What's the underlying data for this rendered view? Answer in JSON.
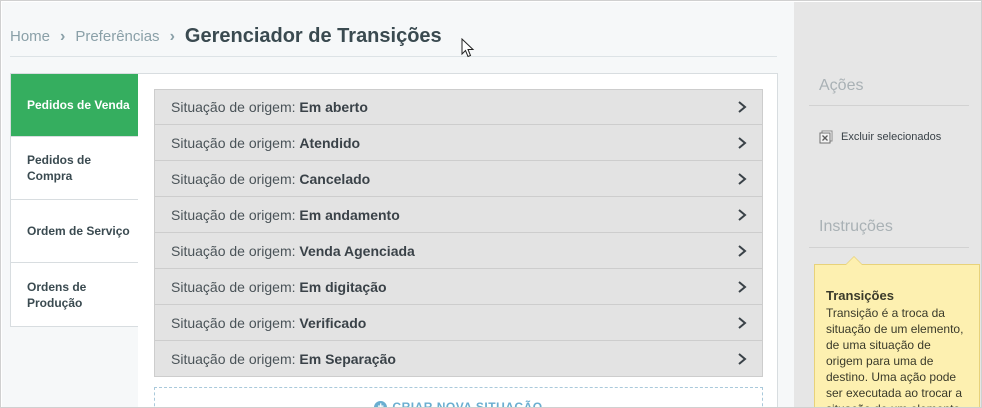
{
  "breadcrumb": {
    "home": "Home",
    "preferences": "Preferências",
    "separator": "›",
    "title": "Gerenciador de Transições"
  },
  "tabs": [
    {
      "label": "Pedidos de Venda",
      "active": true
    },
    {
      "label": "Pedidos de Compra",
      "active": false
    },
    {
      "label": "Ordem de Serviço",
      "active": false
    },
    {
      "label": "Ordens de Produção",
      "active": false
    }
  ],
  "transitions": {
    "prefix": "Situação de origem: ",
    "items": [
      "Em aberto",
      "Atendido",
      "Cancelado",
      "Em andamento",
      "Venda Agenciada",
      "Em digitação",
      "Verificado",
      "Em Separação"
    ]
  },
  "create_button": {
    "label": "CRIAR NOVA SITUAÇÃO",
    "icon": "plus-circle-icon"
  },
  "actions": {
    "heading": "Ações",
    "delete_selected": "Excluir selecionados",
    "delete_icon": "delete-selected-icon"
  },
  "instructions": {
    "heading": "Instruções",
    "tip_title": "Transições",
    "tip_body": "Transição é a troca da situação de um elemento, de uma situação de origem para uma de destino. Uma ação pode ser executada ao trocar a situação de um elemento."
  },
  "colors": {
    "active_tab": "#35ae5f",
    "tip_background": "#fdf0b0",
    "link_blue": "#6aaed0"
  }
}
